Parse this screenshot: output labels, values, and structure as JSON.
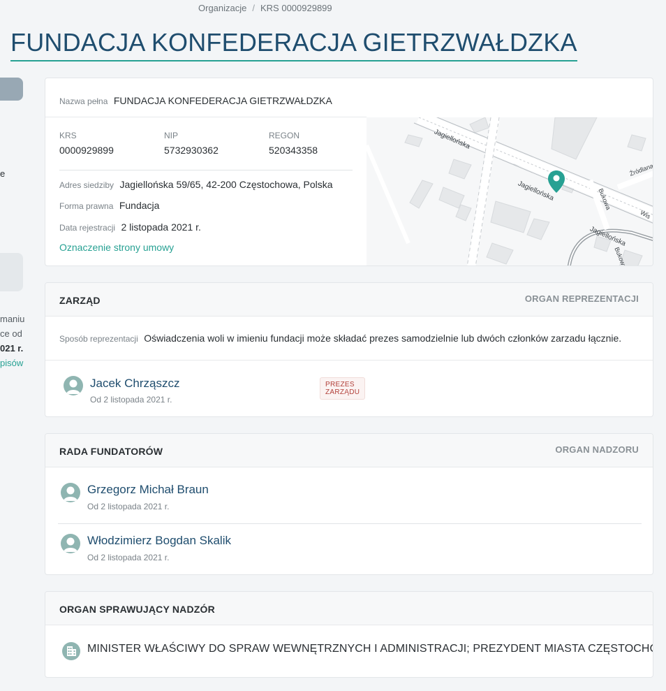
{
  "breadcrumb": {
    "root": "Organizacje",
    "separator": "/",
    "current": "KRS 0000929899"
  },
  "title": "FUNDACJA KONFEDERACJA GIETRZWAŁDZKA",
  "sidebar": {
    "fragment_e": "e",
    "lines": [
      "maniu",
      "ce od",
      "021 r.",
      "pisów"
    ]
  },
  "details": {
    "full_name_label": "Nazwa pełna",
    "full_name": "FUNDACJA KONFEDERACJA GIETRZWAŁDZKA",
    "krs_label": "KRS",
    "krs": "0000929899",
    "nip_label": "NIP",
    "nip": "5732930362",
    "regon_label": "REGON",
    "regon": "520343358",
    "address_label": "Adres siedziby",
    "address": "Jagiellońska 59/65, 42-200 Częstochowa, Polska",
    "legal_form_label": "Forma prawna",
    "legal_form": "Fundacja",
    "reg_date_label": "Data rejestracji",
    "reg_date": "2 listopada 2021 r.",
    "contract_link": "Oznaczenie strony umowy"
  },
  "map": {
    "streets": [
      "Jagiellońska",
      "Jagiellońska",
      "Jagiellońska",
      "Bukowa",
      "Bukowa",
      "Źródlana",
      "Wis"
    ],
    "pin_color": "#27a193"
  },
  "zarzad": {
    "title": "ZARZĄD",
    "role": "ORGAN REPREZENTACJI",
    "repr_label": "Sposób reprezentacji",
    "repr_text": "Oświadczenia woli w imieniu fundacji może składać prezes samodzielnie lub dwóch członków zarzadu łącznie.",
    "members": [
      {
        "name": "Jacek Chrząszcz",
        "since": "Od 2 listopada 2021 r.",
        "badge": "PREZES ZARZĄDU"
      }
    ]
  },
  "rada": {
    "title": "RADA FUNDATORÓW",
    "role": "ORGAN NADZORU",
    "members": [
      {
        "name": "Grzegorz Michał Braun",
        "since": "Od 2 listopada 2021 r."
      },
      {
        "name": "Włodzimierz Bogdan Skalik",
        "since": "Od 2 listopada 2021 r."
      }
    ]
  },
  "nadzor": {
    "title": "ORGAN SPRAWUJĄCY NADZÓR",
    "text": "MINISTER WŁAŚCIWY DO SPRAW WEWNĘTRZNYCH I ADMINISTRACJI; PREZYDENT MIASTA CZĘSTOCHOWY"
  },
  "colors": {
    "accent": "#27a193",
    "title": "#1f4d6e",
    "badge_text": "#b2403a"
  }
}
